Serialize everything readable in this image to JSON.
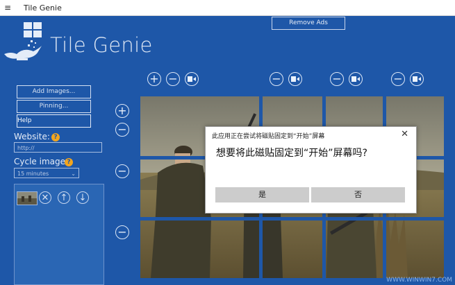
{
  "window": {
    "title": "Tile Genie",
    "menu_glyph": "≡"
  },
  "header": {
    "app_name": "Tile Genie",
    "remove_ads_label": "Remove Ads"
  },
  "left_panel": {
    "add_images_label": "Add Images...",
    "pinning_label": "Pinning...",
    "help_label": "Help",
    "website_label": "Website:",
    "website_value": "http://",
    "cycle_label": "Cycle image:",
    "cycle_value": "15 minutes"
  },
  "dialog": {
    "title": "此应用正在尝试将磁贴固定到“开始”屏幕",
    "message": "想要将此磁贴固定到“开始”屏幕吗?",
    "yes_label": "是",
    "no_label": "否",
    "close_glyph": "✕"
  },
  "watermark": "WWW.WINWIN7.COM",
  "colors": {
    "background": "#1e57a8",
    "dialog_button": "#cccccc",
    "help_icon": "#f2a51e"
  }
}
